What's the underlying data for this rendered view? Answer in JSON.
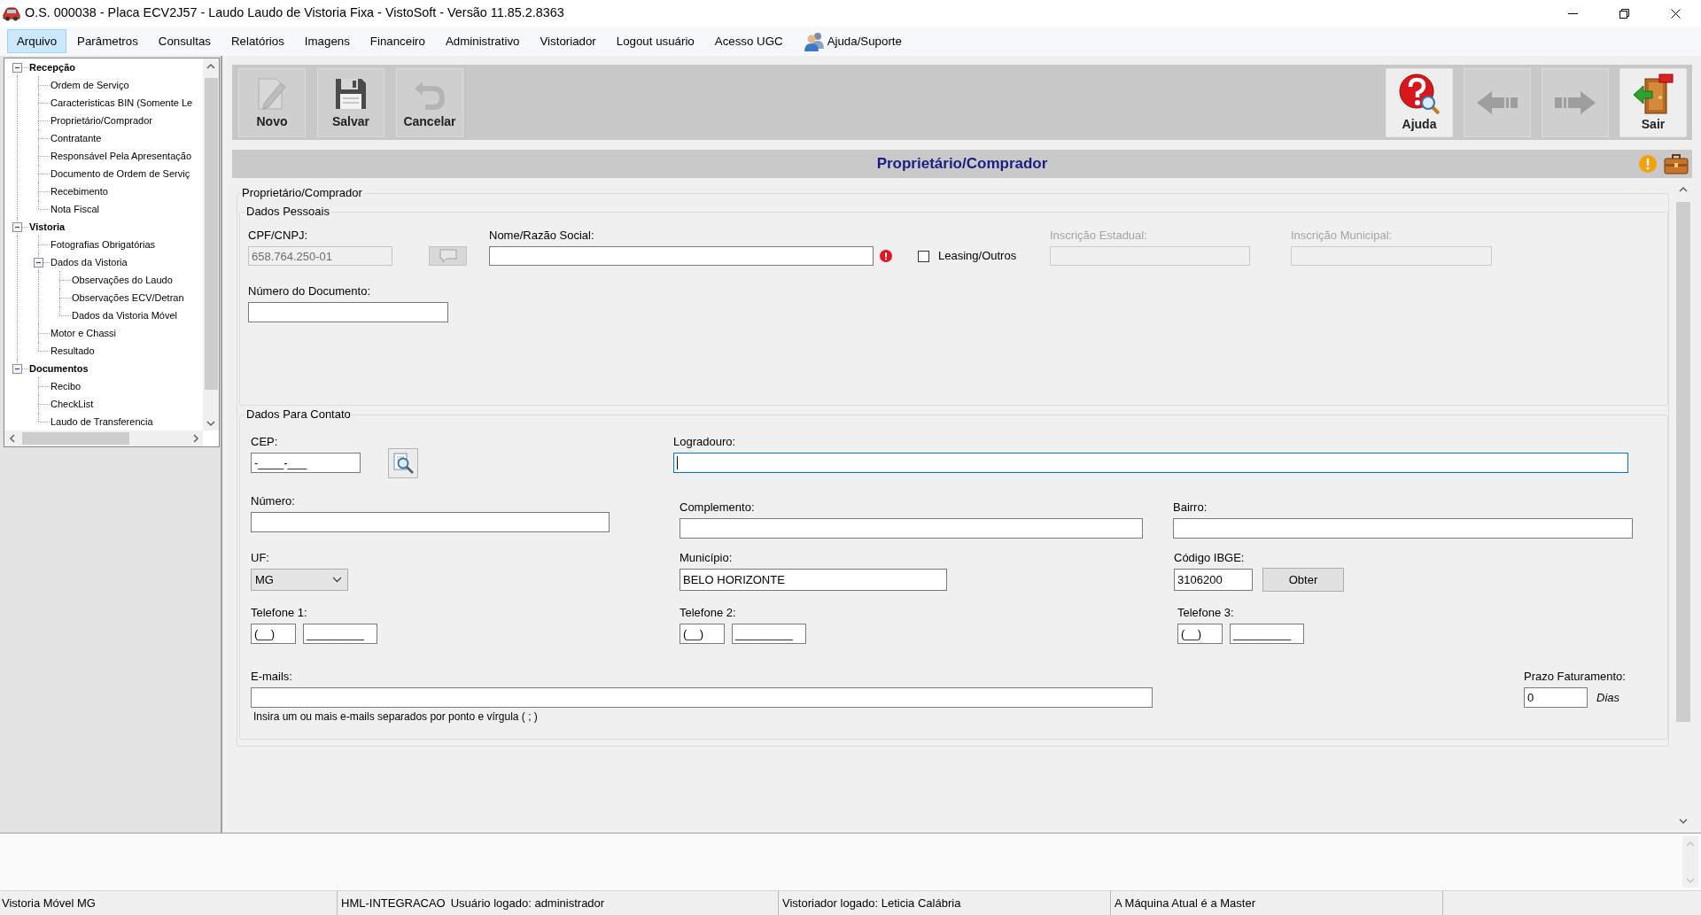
{
  "window": {
    "title": "O.S. 000038 - Placa ECV2J57 - Laudo Laudo de Vistoria Fixa - VistoSoft - Versão 11.85.2.8363"
  },
  "menu": [
    {
      "label": "Arquivo",
      "kind": "text",
      "selected": true
    },
    {
      "label": "Parâmetros",
      "kind": "text",
      "selected": false
    },
    {
      "label": "Consultas",
      "kind": "text",
      "selected": false
    },
    {
      "label": "Relatórios",
      "kind": "text",
      "selected": false
    },
    {
      "label": "Imagens",
      "kind": "text",
      "selected": false
    },
    {
      "label": "Financeiro",
      "kind": "text",
      "selected": false
    },
    {
      "label": "Administrativo",
      "kind": "text",
      "selected": false
    },
    {
      "label": "Vistoriador",
      "kind": "text",
      "selected": false
    },
    {
      "label": "Logout usuário",
      "kind": "text",
      "selected": false
    },
    {
      "label": "Acesso UGC",
      "kind": "text",
      "selected": false
    },
    {
      "label": "Ajuda/Suporte",
      "kind": "icon",
      "selected": false
    }
  ],
  "tree": [
    {
      "label": "Recepção",
      "expanded": true,
      "selected": false,
      "children": [
        {
          "label": "Ordem de Serviço",
          "selected": false
        },
        {
          "label": "Caracteristicas BIN (Somente Le",
          "selected": false
        },
        {
          "label": "Proprietário/Comprador",
          "selected": false
        },
        {
          "label": "Contratante",
          "selected": false
        },
        {
          "label": "Responsável Pela Apresentação",
          "selected": false
        },
        {
          "label": "Documento de Ordem de Serviç",
          "selected": false
        },
        {
          "label": "Recebimento",
          "selected": false
        },
        {
          "label": "Nota Fiscal",
          "selected": false
        }
      ]
    },
    {
      "label": "Vistoria",
      "expanded": true,
      "selected": false,
      "children": [
        {
          "label": "Fotografias Obrigatórias",
          "selected": false
        },
        {
          "label": "Dados da Vistoria",
          "expanded": true,
          "selected": false,
          "children": [
            {
              "label": "Observações do Laudo",
              "selected": false
            },
            {
              "label": "Observações ECV/Detran",
              "selected": false
            },
            {
              "label": "Dados da Vistoria Móvel",
              "selected": false
            }
          ]
        },
        {
          "label": "Motor e Chassi",
          "selected": false
        },
        {
          "label": "Resultado",
          "selected": false
        }
      ]
    },
    {
      "label": "Documentos",
      "expanded": true,
      "selected": false,
      "children": [
        {
          "label": "Recibo",
          "selected": false
        },
        {
          "label": "CheckList",
          "selected": false
        },
        {
          "label": "Laudo de Transferencia",
          "selected": false
        }
      ]
    }
  ],
  "toolbar": {
    "left": [
      {
        "kind": "new",
        "label": "Novo",
        "disabled": true
      },
      {
        "kind": "save",
        "label": "Salvar",
        "disabled": false
      },
      {
        "kind": "cancel",
        "label": "Cancelar",
        "disabled": true
      }
    ],
    "right": [
      {
        "kind": "help",
        "label": "Ajuda",
        "disabled": false
      },
      {
        "kind": "back",
        "disabled": true
      },
      {
        "kind": "forward",
        "disabled": true
      },
      {
        "kind": "exit",
        "label": "Sair",
        "disabled": false
      }
    ]
  },
  "page_header": {
    "title": "Proprietário/Comprador"
  },
  "form": {
    "title": "Proprietário/Comprador",
    "dados_pessoais": {
      "title": "Dados Pessoais",
      "cpf_cnpj": {
        "label": "CPF/CNPJ:",
        "value": "658.764.250-01",
        "readonly": true,
        "button_disabled": true
      },
      "nome_razao_social": {
        "label": "Nome/Razão Social:",
        "error": true
      },
      "leasing_outros": {
        "label": "Leasing/Outros",
        "checked": false
      },
      "inscricao_estadual": {
        "label": "Inscrição Estadual:",
        "disabled": true
      },
      "inscricao_municipal": {
        "label": "Inscrição Municipal:",
        "disabled": true
      },
      "numero_documento": {
        "label": "Número do Documento:"
      }
    },
    "dados_contato": {
      "title": "Dados Para Contato",
      "cep": {
        "label": "CEP:",
        "value": "-____-___"
      },
      "logradouro": {
        "label": "Logradouro:",
        "focused": true
      },
      "numero": {
        "label": "Número:"
      },
      "complemento": {
        "label": "Complemento:"
      },
      "bairro": {
        "label": "Bairro:"
      },
      "uf": {
        "label": "UF:",
        "value": "MG"
      },
      "municipio": {
        "label": "Município:",
        "value": "BELO HORIZONTE"
      },
      "codigo_ibge": {
        "label": "Código IBGE:",
        "value": "3106200",
        "button": "Obter"
      },
      "telefones": [
        {
          "label": "Telefone 1:",
          "ddd": "(__)",
          "number": "_________"
        },
        {
          "label": "Telefone 2:",
          "ddd": "(__)",
          "number": "_________"
        },
        {
          "label": "Telefone 3:",
          "ddd": "(__)",
          "number": "_________"
        }
      ],
      "emails": {
        "label": "E-mails:",
        "hint": "Insira um ou mais e-mails separados por ponto e vírgula ( ; )"
      },
      "prazo_faturamento": {
        "label": "Prazo Faturamento:",
        "value": "0",
        "unit": "Dias"
      }
    }
  },
  "status_bar": [
    {
      "texts": [
        "Vistoria Móvel MG"
      ]
    },
    {
      "texts": [
        "HML-INTEGRACAO",
        "Usuário logado: administrador"
      ]
    },
    {
      "texts": [
        "Vistoriador logado: Leticia Calábria"
      ]
    },
    {
      "texts": [
        "A Máquina Atual é a Master"
      ]
    }
  ]
}
